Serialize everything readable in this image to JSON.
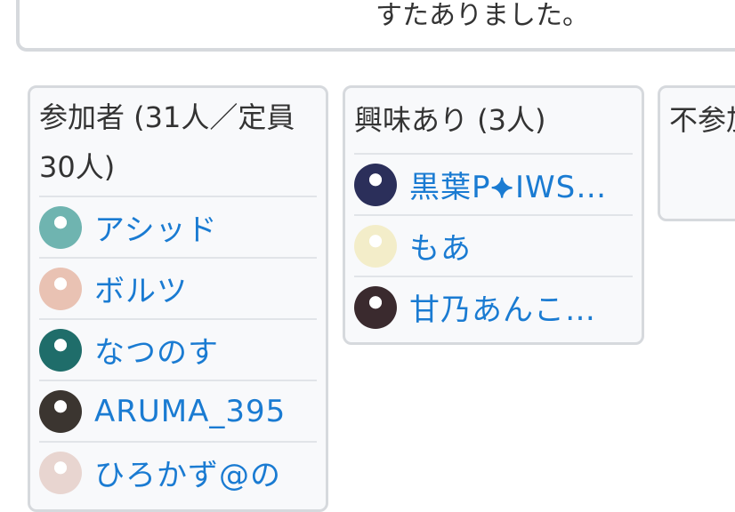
{
  "top_box": {
    "clipped_text": "すたありました。"
  },
  "columns": {
    "attend": {
      "title": "参加者 (31人／定員30人)",
      "members": [
        {
          "name": "アシッド",
          "avatar_color": "#6fb4b0"
        },
        {
          "name": "ボルツ",
          "avatar_color": "#e9c2b3"
        },
        {
          "name": "なつのす",
          "avatar_color": "#1f6d6a"
        },
        {
          "name": "ARUMA_395",
          "avatar_color": "#3b3530"
        },
        {
          "name": "ひろかず@の",
          "avatar_color": "#e8d5d0"
        }
      ]
    },
    "interest": {
      "title": "興味あり (3人)",
      "members": [
        {
          "name": "黒葉P⯌IWS…",
          "avatar_color": "#2b2f5a"
        },
        {
          "name": "もあ",
          "avatar_color": "#f3edc9"
        },
        {
          "name": "甘乃あんこ…",
          "avatar_color": "#3a2a2e"
        }
      ]
    },
    "absent": {
      "title": "不参加"
    }
  }
}
